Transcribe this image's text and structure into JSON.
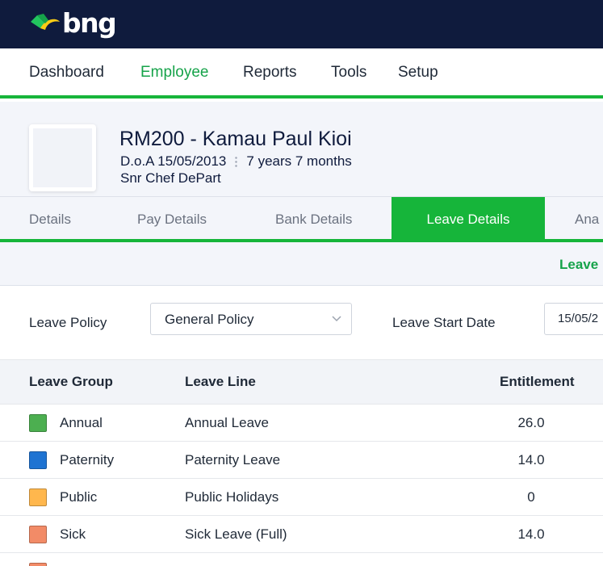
{
  "brand": {
    "name": "bng",
    "primary_color": "#0f1b3d",
    "accent_color": "#16b53a"
  },
  "nav": {
    "items": [
      {
        "label": "Dashboard",
        "active": false
      },
      {
        "label": "Employee",
        "active": true
      },
      {
        "label": "Reports",
        "active": false
      },
      {
        "label": "Tools",
        "active": false
      },
      {
        "label": "Setup",
        "active": false
      }
    ]
  },
  "employee": {
    "name": "RM200 - Kamau Paul Kioi",
    "doa": "D.o.A 15/05/2013",
    "tenure": "7 years 7 months",
    "position": "Snr Chef DePart"
  },
  "tabs": [
    {
      "label": "Details",
      "active": false
    },
    {
      "label": "Pay Details",
      "active": false
    },
    {
      "label": "Bank Details",
      "active": false
    },
    {
      "label": "Leave Details",
      "active": true
    },
    {
      "label": "Ana",
      "active": false
    }
  ],
  "subbar": {
    "link_label": "Leave"
  },
  "form": {
    "leave_policy_label": "Leave Policy",
    "leave_policy_value": "General Policy",
    "leave_start_label": "Leave Start Date",
    "leave_start_value": "15/05/2"
  },
  "table": {
    "columns": [
      "Leave Group",
      "Leave Line",
      "Entitlement"
    ],
    "rows": [
      {
        "color": "#4caf50",
        "group": "Annual",
        "line": "Annual Leave",
        "entitlement": "26.0"
      },
      {
        "color": "#1e73d2",
        "group": "Paternity",
        "line": "Paternity Leave",
        "entitlement": "14.0"
      },
      {
        "color": "#ffb74d",
        "group": "Public",
        "line": "Public Holidays",
        "entitlement": "0"
      },
      {
        "color": "#f28b67",
        "group": "Sick",
        "line": "Sick Leave (Full)",
        "entitlement": "14.0"
      },
      {
        "color": "#f28b67",
        "group": "",
        "line": "",
        "entitlement": ""
      }
    ]
  }
}
